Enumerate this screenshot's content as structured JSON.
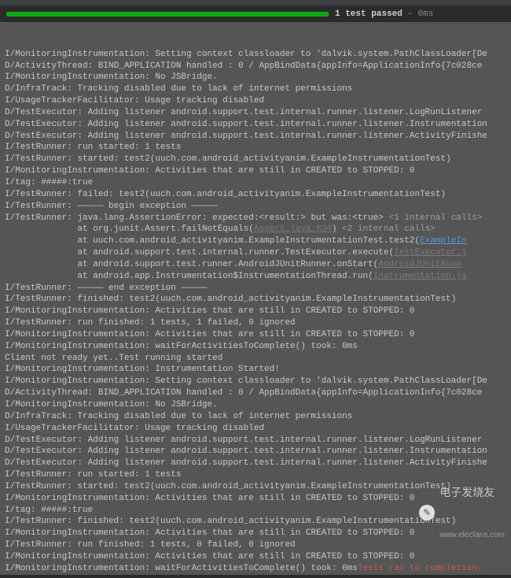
{
  "status": {
    "passed_label": "1 test passed",
    "separator": " – ",
    "time": "0ms"
  },
  "watermark": {
    "icon": "✎",
    "text": "电子发烧友",
    "url": "www.elecfans.com"
  },
  "log_lines": [
    {
      "t": "I/MonitoringInstrumentation: Setting context classloader to 'dalvik.system.PathClassLoader[De"
    },
    {
      "t": "D/ActivityThread: BIND_APPLICATION handled : 0 / AppBindData{appInfo=ApplicationInfo{7c028ce "
    },
    {
      "t": "I/MonitoringInstrumentation: No JSBridge."
    },
    {
      "t": "D/InfraTrack: Tracking disabled due to lack of internet permissions"
    },
    {
      "t": "I/UsageTrackerFacilitator: Usage tracking disabled"
    },
    {
      "t": "D/TestExecutor: Adding listener android.support.test.internal.runner.listener.LogRunListener"
    },
    {
      "t": "D/TestExecutor: Adding listener android.support.test.internal.runner.listener.Instrumentation"
    },
    {
      "t": "D/TestExecutor: Adding listener android.support.test.internal.runner.listener.ActivityFinishe"
    },
    {
      "t": "I/TestRunner: run started: 1 tests"
    },
    {
      "t": "I/TestRunner: started: test2(uuch.com.android_activityanim.ExampleInstrumentationTest)"
    },
    {
      "t": "I/MonitoringInstrumentation: Activities that are still in CREATED to STOPPED: 0"
    },
    {
      "t": "I/tag: #####:true"
    },
    {
      "t": "I/TestRunner: failed: test2(uuch.com.android_activityanim.ExampleInstrumentationTest)"
    },
    {
      "t": "I/TestRunner: ————— begin exception —————"
    },
    {
      "segments": [
        {
          "t": "I/TestRunner: java.lang.AssertionError: expected:<result:> but was:<true> "
        },
        {
          "t": "<1 internal calls>",
          "cls": "gray-text"
        }
      ]
    },
    {
      "segments": [
        {
          "t": "              at org.junit.Assert.failNotEquals("
        },
        {
          "t": "Assert.java:834",
          "cls": "gray-link"
        },
        {
          "t": ") "
        },
        {
          "t": "<2 internal calls>",
          "cls": "gray-text"
        }
      ]
    },
    {
      "segments": [
        {
          "t": "              at uuch.com.android_activityanim.ExampleInstrumentationTest.test2("
        },
        {
          "t": "ExampleIn",
          "cls": "link"
        }
      ]
    },
    {
      "segments": [
        {
          "t": "              at android.support.test.internal.runner.TestExecutor.execute("
        },
        {
          "t": "TestExecutor.j",
          "cls": "gray-link"
        }
      ]
    },
    {
      "segments": [
        {
          "t": "              at android.support.test.runner.AndroidJUnitRunner.onStart("
        },
        {
          "t": "AndroidJUnitRunn",
          "cls": "gray-link"
        }
      ]
    },
    {
      "segments": [
        {
          "t": "              at android.app.Instrumentation$InstrumentationThread.run("
        },
        {
          "t": "Instrumentation.ja",
          "cls": "gray-link"
        }
      ]
    },
    {
      "t": "I/TestRunner: ————— end exception —————"
    },
    {
      "t": "I/TestRunner: finished: test2(uuch.com.android_activityanim.ExampleInstrumentationTest)"
    },
    {
      "t": "I/MonitoringInstrumentation: Activities that are still in CREATED to STOPPED: 0"
    },
    {
      "t": "I/TestRunner: run finished: 1 tests, 1 failed, 0 ignored"
    },
    {
      "t": "I/MonitoringInstrumentation: Activities that are still in CREATED to STOPPED: 0"
    },
    {
      "t": "I/MonitoringInstrumentation: waitForActivitiesToComplete() took: 0ms"
    },
    {
      "t": "Client not ready yet..Test running started"
    },
    {
      "t": "I/MonitoringInstrumentation: Instrumentation Started!"
    },
    {
      "t": "I/MonitoringInstrumentation: Setting context classloader to 'dalvik.system.PathClassLoader[De"
    },
    {
      "t": "D/ActivityThread: BIND_APPLICATION handled : 0 / AppBindData{appInfo=ApplicationInfo{7c028ce "
    },
    {
      "t": "I/MonitoringInstrumentation: No JSBridge."
    },
    {
      "t": "D/InfraTrack: Tracking disabled due to lack of internet permissions"
    },
    {
      "t": "I/UsageTrackerFacilitator: Usage tracking disabled"
    },
    {
      "t": "D/TestExecutor: Adding listener android.support.test.internal.runner.listener.LogRunListener"
    },
    {
      "t": "D/TestExecutor: Adding listener android.support.test.internal.runner.listener.Instrumentation"
    },
    {
      "t": "D/TestExecutor: Adding listener android.support.test.internal.runner.listener.ActivityFinishe"
    },
    {
      "t": "I/TestRunner: run started: 1 tests"
    },
    {
      "t": "I/TestRunner: started: test2(uuch.com.android_activityanim.ExampleInstrumentationTest)"
    },
    {
      "t": "I/MonitoringInstrumentation: Activities that are still in CREATED to STOPPED: 0"
    },
    {
      "t": "I/tag: #####:true"
    },
    {
      "t": "I/TestRunner: finished: test2(uuch.com.android_activityanim.ExampleInstrumentationTest)"
    },
    {
      "t": "I/MonitoringInstrumentation: Activities that are still in CREATED to STOPPED: 0"
    },
    {
      "t": "I/TestRunner: run finished: 1 tests, 0 failed, 0 ignored"
    },
    {
      "t": "I/MonitoringInstrumentation: Activities that are still in CREATED to STOPPED: 0"
    },
    {
      "segments": [
        {
          "t": "I/MonitoringInstrumentation: waitForActivitiesToComplete() took: 0ms"
        },
        {
          "t": "Tests ran to completion.",
          "cls": "red-text"
        }
      ]
    }
  ]
}
